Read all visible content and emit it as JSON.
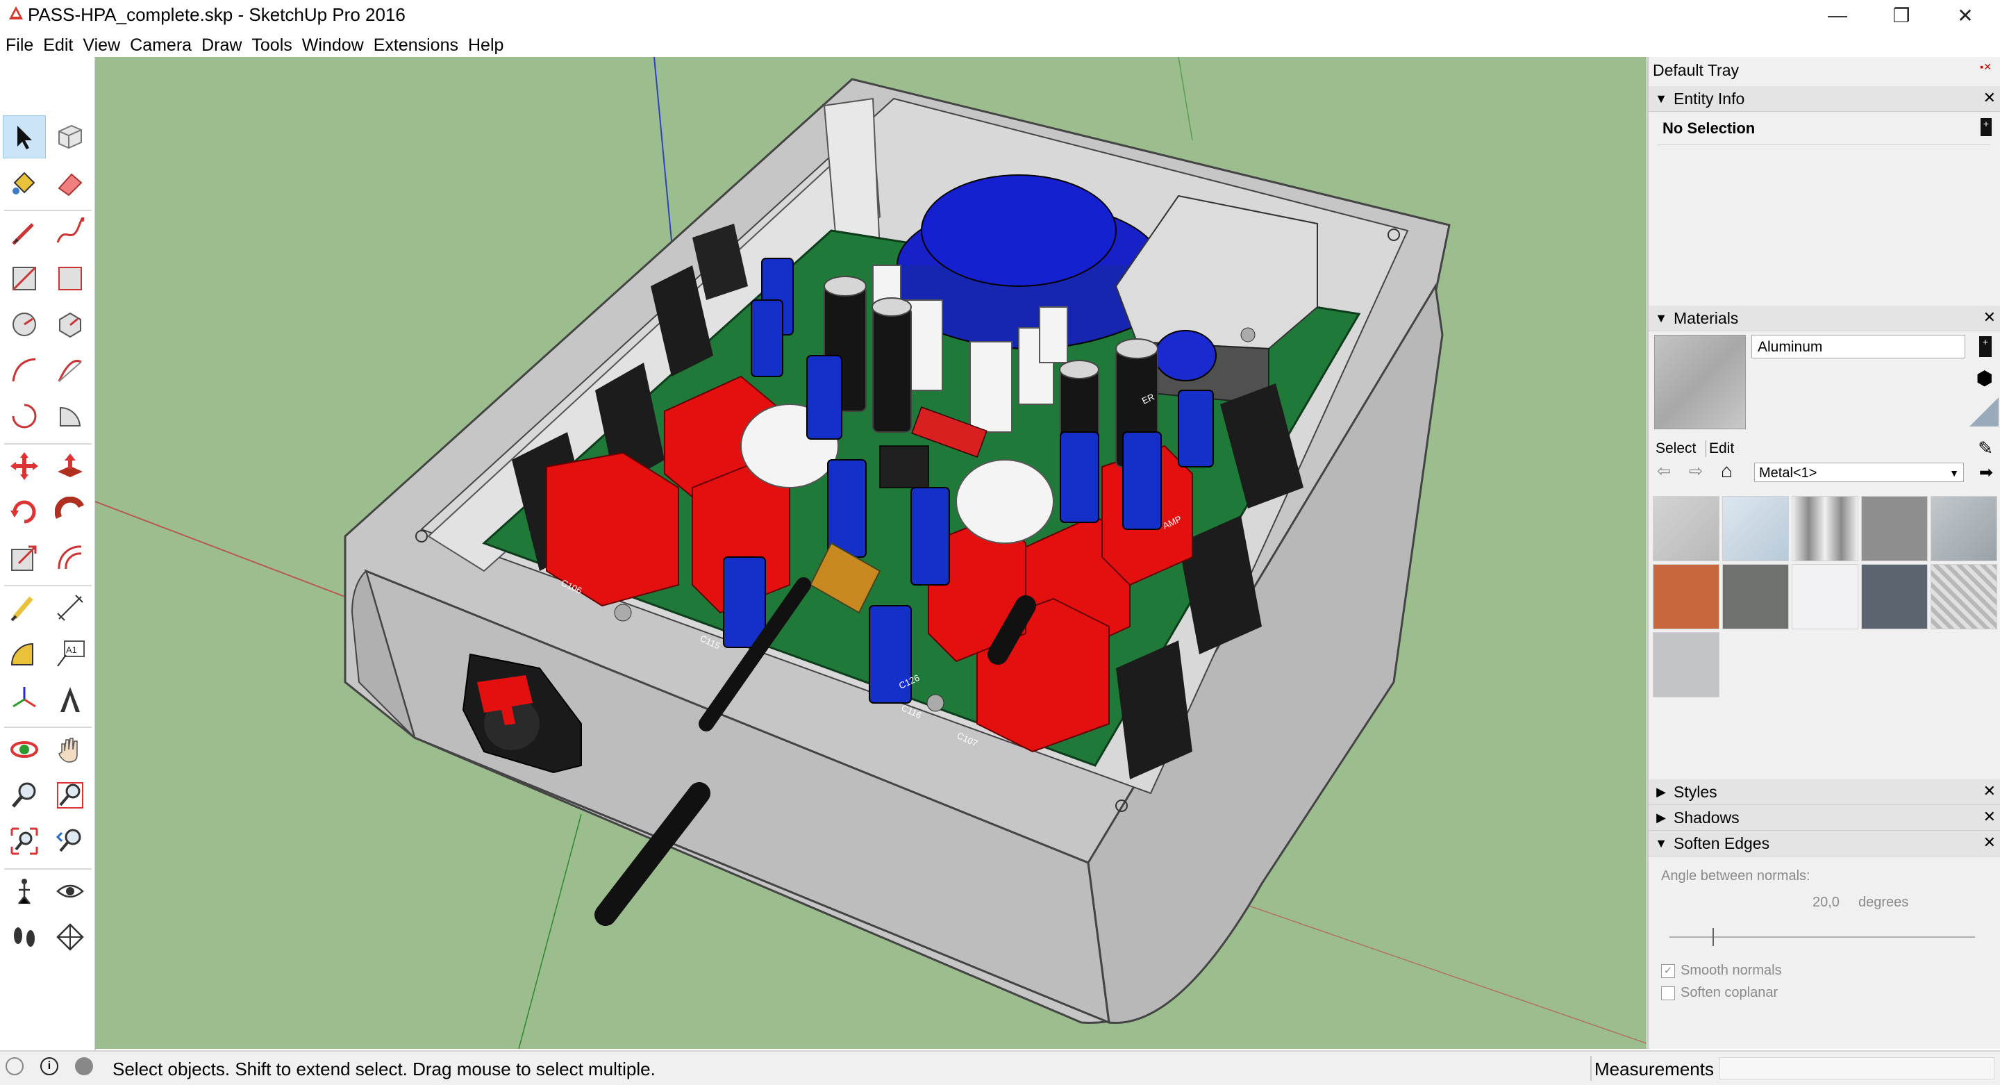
{
  "window": {
    "title": "PASS-HPA_complete.skp - SketchUp Pro 2016",
    "controls": {
      "minimize": "—",
      "restore": "❐",
      "close": "✕"
    }
  },
  "menu": [
    "File",
    "Edit",
    "View",
    "Camera",
    "Draw",
    "Tools",
    "Window",
    "Extensions",
    "Help"
  ],
  "toolbar": {
    "tools": [
      "select-tool-icon",
      "component-tool-icon",
      "paint-bucket-icon",
      "eraser-icon",
      "pencil-line-icon",
      "freehand-icon",
      "rectangle-icon",
      "rotated-rectangle-icon",
      "circle-icon",
      "polygon-icon",
      "arc-icon",
      "two-point-arc-icon",
      "three-point-arc-icon",
      "pie-icon",
      "move-icon",
      "push-pull-icon",
      "rotate-icon",
      "follow-me-icon",
      "scale-icon",
      "offset-icon",
      "tape-measure-icon",
      "dimension-icon",
      "protractor-icon",
      "text-label-icon",
      "axes-icon",
      "3d-text-icon",
      "orbit-icon",
      "pan-icon",
      "zoom-icon",
      "zoom-window-icon",
      "zoom-extents-icon",
      "previous-view-icon",
      "position-camera-icon",
      "look-around-icon",
      "walk-icon",
      "section-plane-icon"
    ],
    "text_tool_label": "A1"
  },
  "tray": {
    "title": "Default Tray",
    "entity_info": {
      "header": "Entity Info",
      "selection": "No Selection"
    },
    "materials": {
      "header": "Materials",
      "current_name": "Aluminum",
      "tab_select": "Select",
      "tab_edit": "Edit",
      "library": "Metal<1>",
      "swatches": [
        "#c8c8c8",
        "#cfd9e3",
        "#d8d8d8",
        "#9a9a9a",
        "#b6bcc0",
        "#c8663e",
        "#6f726e",
        "#f2f2f4",
        "#5c6470",
        "#d6d6d6",
        "#c2c4c6"
      ]
    },
    "collapsed": [
      "Styles",
      "Shadows"
    ],
    "soften_edges": {
      "header": "Soften Edges",
      "angle_label": "Angle between normals:",
      "angle_value": "20,0",
      "angle_unit": "degrees",
      "angle_slider_fraction": 0.14,
      "smooth_normals": {
        "label": "Smooth normals",
        "checked": true
      },
      "soften_coplanar": {
        "label": "Soften coplanar",
        "checked": false
      }
    }
  },
  "status": {
    "message": "Select objects. Shift to extend select. Drag mouse to select multiple.",
    "measurements_label": "Measurements"
  },
  "scene": {
    "board_labels": [
      "C106",
      "C115",
      "C116",
      "C107",
      "C126",
      "AMP",
      "ER"
    ]
  },
  "colors": {
    "viewport_bg": "#9cbe8e",
    "enclosure": "#c6c6c6",
    "pcb": "#1f7a3a",
    "capacitor_blue": "#1530c8",
    "relay_red": "#e41010",
    "heatsink_black": "#1c1c1c",
    "selection_blue": "#cce4f7"
  }
}
